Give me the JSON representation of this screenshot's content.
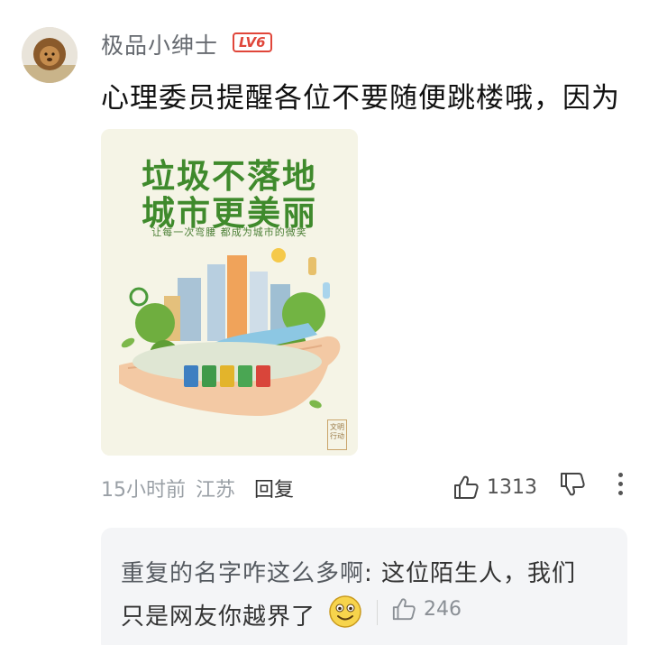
{
  "comment": {
    "username": "极品小绅士",
    "level": "LV6",
    "text": "心理委员提醒各位不要随便跳楼哦，因为",
    "time": "15小时前",
    "location": "江苏",
    "reply_label": "回复",
    "like_count": "1313"
  },
  "poster": {
    "title_line1": "垃圾不落地",
    "title_line2": "城市更美丽",
    "subtitle": "让每一次弯腰 都成为城市的微笑",
    "stamp": "文明行动"
  },
  "reply": {
    "author": "重复的名字咋这么多啊",
    "separator": ": ",
    "text_line1": "这位陌生人，我们",
    "text_line2": "只是网友你越界了",
    "like_count": "246"
  },
  "icons": {
    "like": "thumbs-up-icon",
    "dislike": "thumbs-down-icon",
    "more": "more-vertical-icon",
    "emoji": "smiling-face-emoji"
  },
  "colors": {
    "level_badge": "#e0463a",
    "poster_green": "#3f8a2c",
    "reply_bg": "#f4f5f7"
  }
}
